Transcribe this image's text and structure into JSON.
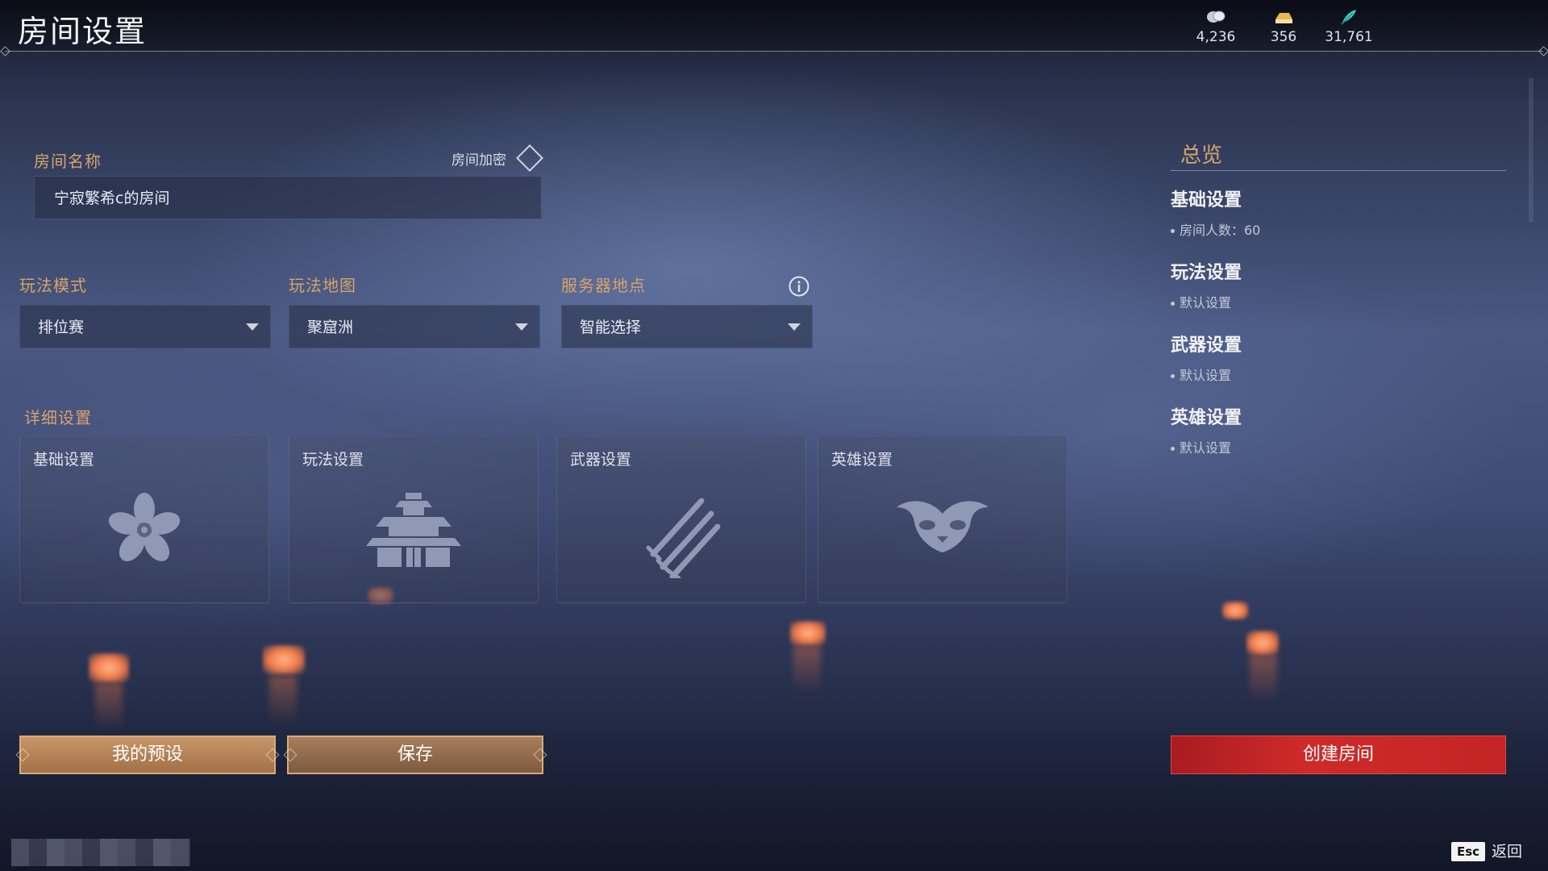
{
  "header": {
    "title": "房间设置",
    "currencies": [
      {
        "icon": "coin-icon",
        "value": "4,236"
      },
      {
        "icon": "gold-ingot-icon",
        "value": "356"
      },
      {
        "icon": "feather-icon",
        "value": "31,761"
      }
    ]
  },
  "room": {
    "name_label": "房间名称",
    "name_value": "宁寂繁希c的房间",
    "encrypt_label": "房间加密"
  },
  "selects": [
    {
      "label": "玩法模式",
      "value": "排位赛"
    },
    {
      "label": "玩法地图",
      "value": "聚窟洲"
    },
    {
      "label": "服务器地点",
      "value": "智能选择"
    }
  ],
  "details": {
    "label": "详细设置",
    "cards": [
      {
        "title": "基础设置",
        "icon": "flower-icon"
      },
      {
        "title": "玩法设置",
        "icon": "pagoda-icon"
      },
      {
        "title": "武器设置",
        "icon": "swords-icon"
      },
      {
        "title": "英雄设置",
        "icon": "mask-icon"
      }
    ]
  },
  "overview": {
    "title": "总览",
    "sections": [
      {
        "heading": "基础设置",
        "item": "房间人数：60"
      },
      {
        "heading": "玩法设置",
        "item": "默认设置"
      },
      {
        "heading": "武器设置",
        "item": "默认设置"
      },
      {
        "heading": "英雄设置",
        "item": "默认设置"
      }
    ]
  },
  "buttons": {
    "presets": "我的预设",
    "save": "保存",
    "create": "创建房间"
  },
  "footer": {
    "esc_key": "Esc",
    "back_label": "返回"
  },
  "colors": {
    "accent_gold": "#d6a46a",
    "create_red": "#c42426"
  }
}
